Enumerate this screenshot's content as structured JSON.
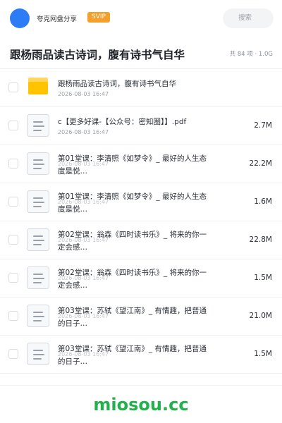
{
  "header": {
    "user_name": "夸克网盘分享",
    "badge": "SVIP",
    "search_placeholder": "搜索",
    "avatar_color": "#2d7cf6"
  },
  "folder": {
    "title": "跟杨雨品读古诗词，腹有诗书气自华",
    "meta": "共 84 项 · 1.0G"
  },
  "files": [
    {
      "type": "folder",
      "name": "跟杨雨品读古诗词，腹有诗书气自华",
      "date": "2026-08-03 16:47",
      "size": ""
    },
    {
      "type": "pdf",
      "name": "c【更多好课-【公众号：密知圈】】.pdf",
      "date": "2026-08-03 16:47",
      "size": "2.7M"
    },
    {
      "type": "file",
      "name": "第01堂课：李清照《如梦令》_ 最好的人生态度是悦…",
      "date": "2026-08-03 16:47",
      "size": "22.2M"
    },
    {
      "type": "file",
      "name": "第01堂课：李清照《如梦令》_ 最好的人生态度是悦…",
      "date": "2026-08-03 16:47",
      "size": "1.6M"
    },
    {
      "type": "file",
      "name": "第02堂课：翁森《四时读书乐》_ 将来的你一定会感…",
      "date": "2026-08-03 16:47",
      "size": "22.8M"
    },
    {
      "type": "file",
      "name": "第02堂课：翁森《四时读书乐》_ 将来的你一定会感…",
      "date": "2026-08-03 16:47",
      "size": "1.5M"
    },
    {
      "type": "file",
      "name": "第03堂课：苏轼《望江南》_ 有情趣，把普通的日子…",
      "date": "2026-08-03 16:47",
      "size": "21.0M"
    },
    {
      "type": "file",
      "name": "第03堂课：苏轼《望江南》_ 有情趣，把普通的日子…",
      "date": "2026-08-03 16:47",
      "size": "1.5M"
    }
  ],
  "watermark": "miosou.cc",
  "colors": {
    "accent": "#2d7cf6",
    "svip": "#f4a02a",
    "folder": "#ffc300",
    "watermark": "#22b14c"
  }
}
